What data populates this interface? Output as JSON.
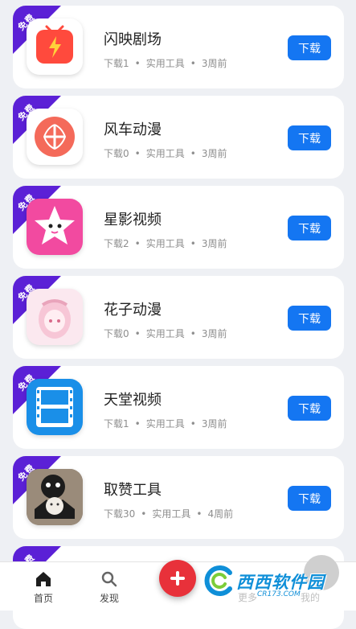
{
  "badge": "免费",
  "download_label": "下载",
  "apps": [
    {
      "name": "闪映剧场",
      "downloads": "下载1",
      "category": "实用工具",
      "time": "3周前",
      "icon": "tv-lightning-icon"
    },
    {
      "name": "风车动漫",
      "downloads": "下载0",
      "category": "实用工具",
      "time": "3周前",
      "icon": "pinwheel-icon"
    },
    {
      "name": "星影视频",
      "downloads": "下载2",
      "category": "实用工具",
      "time": "3周前",
      "icon": "star-face-icon"
    },
    {
      "name": "花子动漫",
      "downloads": "下载0",
      "category": "实用工具",
      "time": "3周前",
      "icon": "anime-girl-icon"
    },
    {
      "name": "天堂视频",
      "downloads": "下载1",
      "category": "实用工具",
      "time": "3周前",
      "icon": "film-strip-icon"
    },
    {
      "name": "取赞工具",
      "downloads": "下载30",
      "category": "实用工具",
      "time": "4周前",
      "icon": "cat-photo-icon"
    }
  ],
  "nav": {
    "home": "首页",
    "discover": "发现",
    "more": "更多",
    "mine": "我的"
  },
  "watermark": {
    "brand": "西西软件园",
    "url": "CR173.COM"
  }
}
